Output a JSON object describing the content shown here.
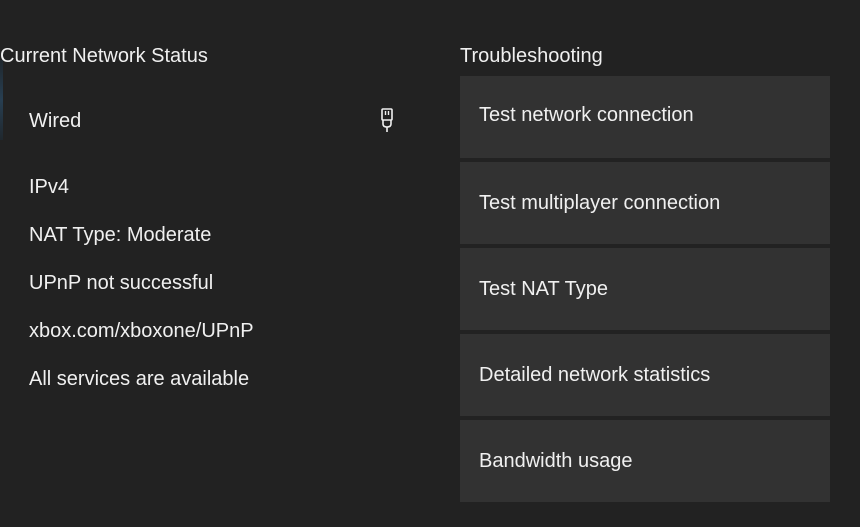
{
  "network_status": {
    "title": "Current Network Status",
    "connection": {
      "label": "Wired",
      "icon": "ethernet-plug-icon"
    },
    "lines": [
      "IPv4",
      "NAT Type: Moderate",
      "UPnP not successful",
      "xbox.com/xboxone/UPnP",
      "All services are available"
    ]
  },
  "troubleshooting": {
    "title": "Troubleshooting",
    "items": [
      "Test network connection",
      "Test multiplayer connection",
      "Test NAT Type",
      "Detailed network statistics",
      "Bandwidth usage"
    ]
  },
  "colors": {
    "background": "#222222",
    "tile": "#323232",
    "text": "#f0f0f0"
  }
}
